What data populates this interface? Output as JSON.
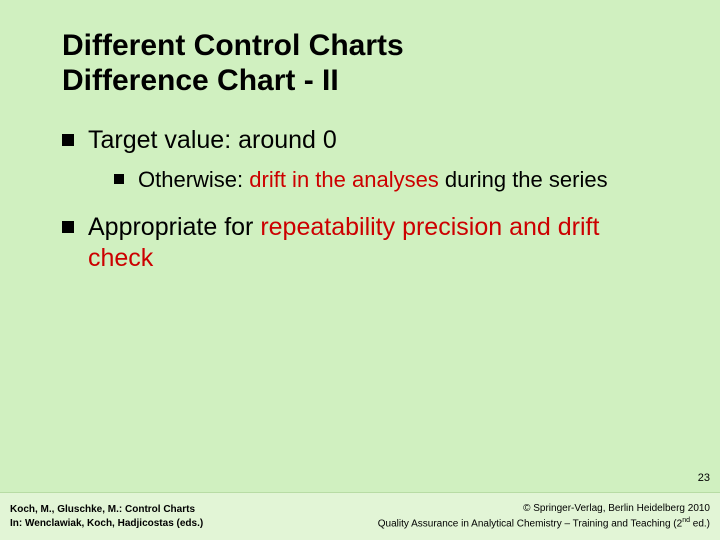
{
  "slide": {
    "title_line1": "Different Control Charts",
    "title_line2": "Difference Chart - II",
    "bullets": {
      "b1_prefix": "Target value: around 0",
      "b1_sub_prefix": "Otherwise: ",
      "b1_sub_red": "drift in the analyses",
      "b1_sub_suffix": " during the series",
      "b2_prefix": "Appropriate for ",
      "b2_red": "repeatability precision and drift check"
    },
    "page_number": "23"
  },
  "footer": {
    "left_line1": "Koch, M., Gluschke, M.: Control Charts",
    "left_line2": "In: Wenclawiak, Koch, Hadjicostas (eds.)",
    "right_line1": "© Springer-Verlag, Berlin Heidelberg 2010",
    "right_line2_a": "Quality Assurance in Analytical Chemistry – Training and Teaching (2",
    "right_line2_sup": "nd",
    "right_line2_b": " ed.)"
  }
}
